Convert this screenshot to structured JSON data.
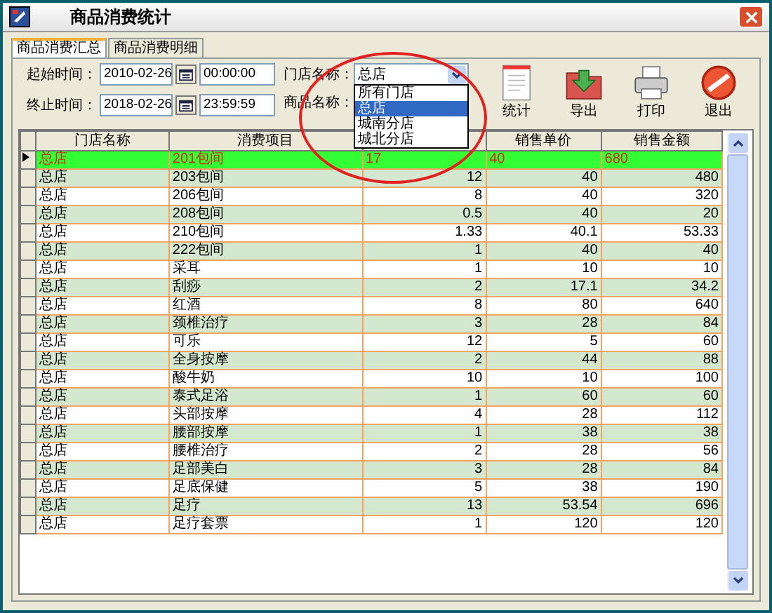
{
  "window": {
    "title": "商品消费统计"
  },
  "tabs": [
    {
      "label": "商品消费汇总",
      "selected": true
    },
    {
      "label": "商品消费明细",
      "selected": false
    }
  ],
  "filters": {
    "start_label": "起始时间：",
    "start_date": "2010-02-26",
    "start_time": "00:00:00",
    "end_label": "终止时间：",
    "end_date": "2018-02-26",
    "end_time": "23:59:59",
    "store_label": "门店名称：",
    "store_value": "总店",
    "product_label": "商品名称：",
    "store_options": [
      {
        "label": "所有门店",
        "selected": false
      },
      {
        "label": "总店",
        "selected": true
      },
      {
        "label": "城南分店",
        "selected": false
      },
      {
        "label": "城北分店",
        "selected": false
      }
    ]
  },
  "toolbar": [
    {
      "label": "统计",
      "kind": "report"
    },
    {
      "label": "导出",
      "kind": "export"
    },
    {
      "label": "打印",
      "kind": "print"
    },
    {
      "label": "退出",
      "kind": "exit"
    }
  ],
  "table": {
    "columns": [
      {
        "label": "门店名称"
      },
      {
        "label": "消费项目"
      },
      {},
      {
        "label": "销售单价"
      },
      {
        "label": "销售金额"
      }
    ],
    "rows": [
      {
        "cells": [
          "总店",
          "201包间",
          "17",
          "40",
          "680"
        ],
        "selected": true
      },
      {
        "cells": [
          "总店",
          "203包间",
          "12",
          "40",
          "480"
        ],
        "selected": false
      },
      {
        "cells": [
          "总店",
          "206包间",
          "8",
          "40",
          "320"
        ],
        "selected": false
      },
      {
        "cells": [
          "总店",
          "208包间",
          "0.5",
          "40",
          "20"
        ],
        "selected": false
      },
      {
        "cells": [
          "总店",
          "210包间",
          "1.33",
          "40.1",
          "53.33"
        ],
        "selected": false
      },
      {
        "cells": [
          "总店",
          "222包间",
          "1",
          "40",
          "40"
        ],
        "selected": false
      },
      {
        "cells": [
          "总店",
          "采耳",
          "1",
          "10",
          "10"
        ],
        "selected": false
      },
      {
        "cells": [
          "总店",
          "刮痧",
          "2",
          "17.1",
          "34.2"
        ],
        "selected": false
      },
      {
        "cells": [
          "总店",
          "红酒",
          "8",
          "80",
          "640"
        ],
        "selected": false
      },
      {
        "cells": [
          "总店",
          "颈椎治疗",
          "3",
          "28",
          "84"
        ],
        "selected": false
      },
      {
        "cells": [
          "总店",
          "可乐",
          "12",
          "5",
          "60"
        ],
        "selected": false
      },
      {
        "cells": [
          "总店",
          "全身按摩",
          "2",
          "44",
          "88"
        ],
        "selected": false
      },
      {
        "cells": [
          "总店",
          "酸牛奶",
          "10",
          "10",
          "100"
        ],
        "selected": false
      },
      {
        "cells": [
          "总店",
          "泰式足浴",
          "1",
          "60",
          "60"
        ],
        "selected": false
      },
      {
        "cells": [
          "总店",
          "头部按摩",
          "4",
          "28",
          "112"
        ],
        "selected": false
      },
      {
        "cells": [
          "总店",
          "腰部按摩",
          "1",
          "38",
          "38"
        ],
        "selected": false
      },
      {
        "cells": [
          "总店",
          "腰椎治疗",
          "2",
          "28",
          "56"
        ],
        "selected": false
      },
      {
        "cells": [
          "总店",
          "足部美白",
          "3",
          "28",
          "84"
        ],
        "selected": false
      },
      {
        "cells": [
          "总店",
          "足底保健",
          "5",
          "38",
          "190"
        ],
        "selected": false
      },
      {
        "cells": [
          "总店",
          "足疗",
          "13",
          "53.54",
          "696"
        ],
        "selected": false
      },
      {
        "cells": [
          "总店",
          "足疗套票",
          "1",
          "120",
          "120"
        ],
        "selected": false
      }
    ]
  }
}
